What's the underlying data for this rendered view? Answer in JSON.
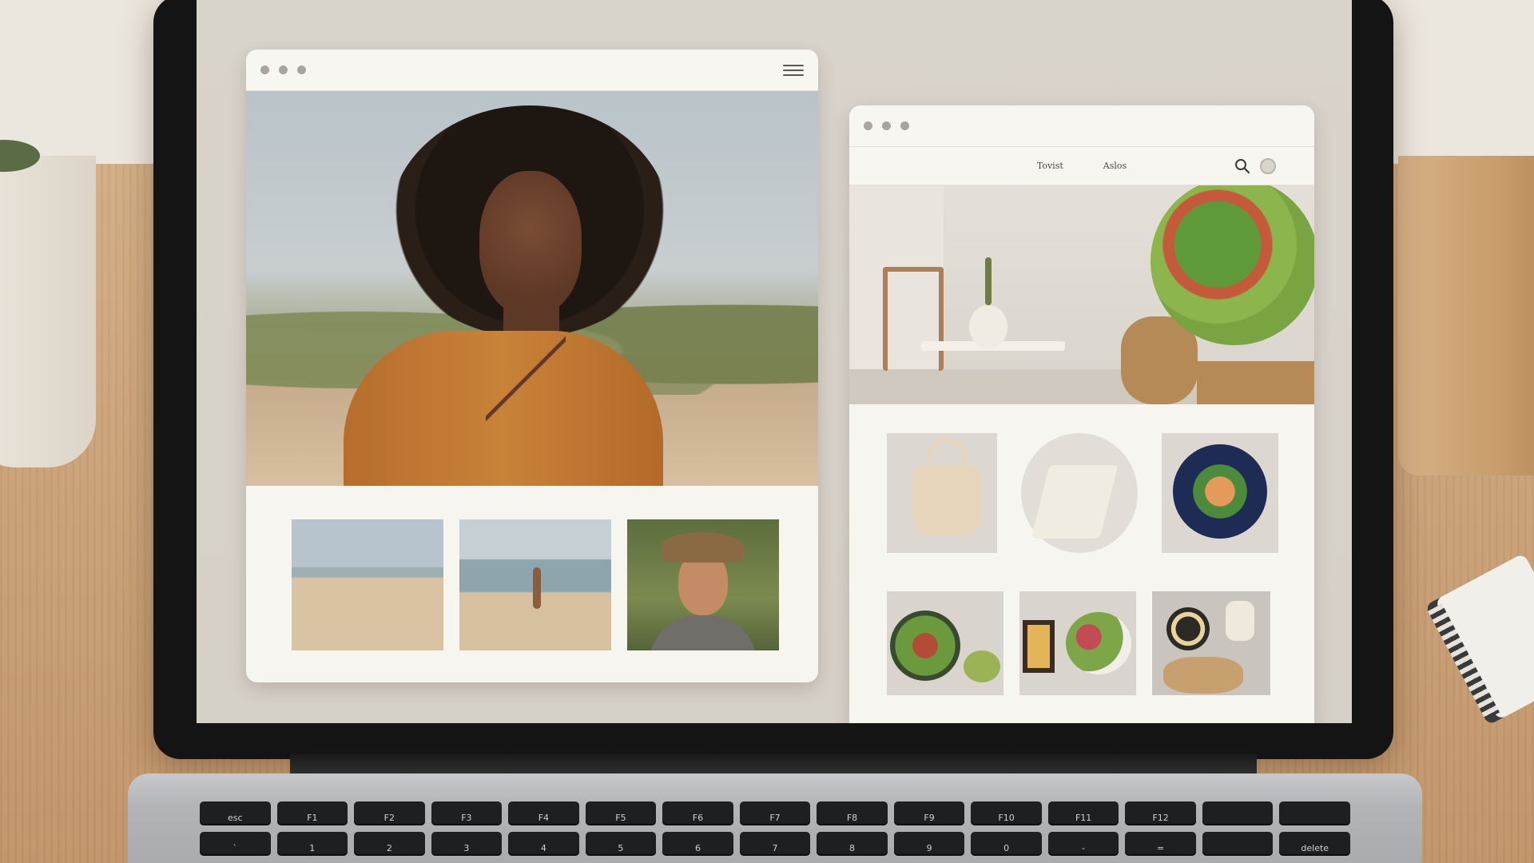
{
  "scene": {
    "colors": {
      "desk": "#c9a077",
      "wall": "#ebe6de",
      "screen_bg": "#d5d0c8",
      "card_bg": "#f7f5ef"
    }
  },
  "window_left": {
    "titlebar": {
      "dots": 3,
      "menu_icon": "hamburger-menu-icon"
    },
    "hero_image": "portrait-woman-orange-shirt-beach",
    "thumbnails": [
      {
        "subject": "sandy-beach-shoreline"
      },
      {
        "subject": "person-walking-on-beach"
      },
      {
        "subject": "smiling-man-in-hat"
      }
    ]
  },
  "window_right": {
    "titlebar": {
      "dots": 3
    },
    "nav": {
      "links": [
        "Tovist",
        "Aslos"
      ],
      "icons": [
        "search-icon",
        "profile-circle-icon"
      ]
    },
    "banner_image": "minimal-interior-with-salad-bowl",
    "grid_row_1": [
      {
        "subject": "canvas-tote-bag"
      },
      {
        "subject": "folded-linen-cloth"
      },
      {
        "subject": "colorful-plated-dish"
      }
    ],
    "grid_row_2": [
      {
        "subject": "salad-bowl-with-side"
      },
      {
        "subject": "framed-art-and-salad"
      },
      {
        "subject": "kitchen-tools-and-bread"
      }
    ]
  },
  "keyboard": {
    "row_1": [
      "esc",
      "F1",
      "F2",
      "F3",
      "F4",
      "F5",
      "F6",
      "F7",
      "F8",
      "F9",
      "F10",
      "F11",
      "F12",
      "",
      ""
    ],
    "row_2": [
      "`",
      "1",
      "2",
      "3",
      "4",
      "5",
      "6",
      "7",
      "8",
      "9",
      "0",
      "-",
      "=",
      "",
      "delete"
    ]
  }
}
